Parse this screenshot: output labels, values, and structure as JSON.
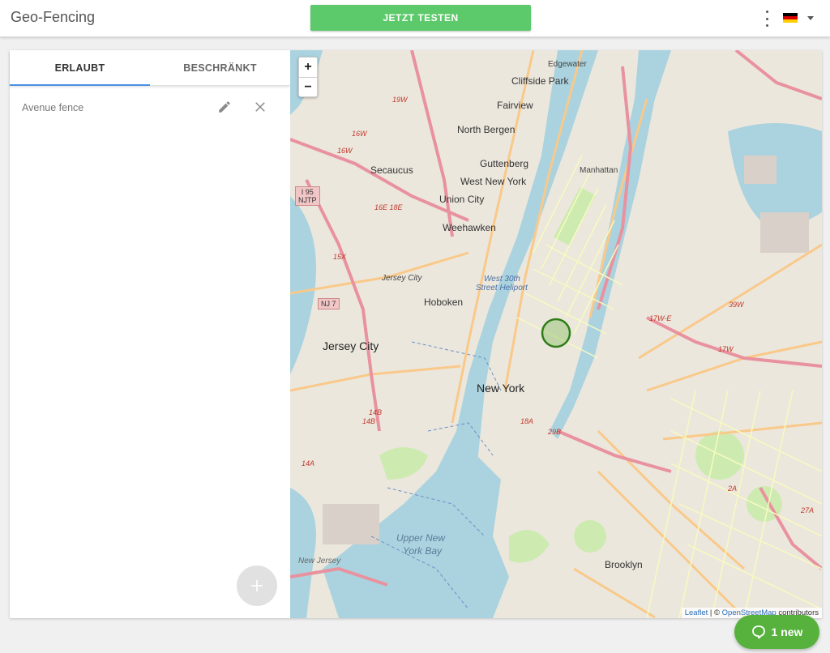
{
  "header": {
    "title": "Geo-Fencing",
    "test_button": "JETZT TESTEN",
    "language_flag": "flag-de"
  },
  "tabs": [
    {
      "label": "ERLAUBT",
      "active": true
    },
    {
      "label": "BESCHRÄNKT",
      "active": false
    }
  ],
  "fences": [
    {
      "name": "Avenue fence"
    }
  ],
  "map": {
    "zoom_in": "+",
    "zoom_out": "−",
    "places": {
      "edgewater": "Edgewater",
      "cliffside_park": "Cliffside Park",
      "fairview": "Fairview",
      "north_bergen": "North Bergen",
      "guttenberg": "Guttenberg",
      "secaucus": "Secaucus",
      "west_new_york": "West New York",
      "union_city": "Union City",
      "manhattan": "Manhattan",
      "weehawken": "Weehawken",
      "jersey_city_small": "Jersey City",
      "hoboken": "Hoboken",
      "west_30th": "West 30th",
      "street_heliport": "Street Heliport",
      "jersey_city": "Jersey City",
      "new_york": "New York",
      "upper_new_york_bay_1": "Upper New",
      "upper_new_york_bay_2": "York Bay",
      "brooklyn": "Brooklyn",
      "new_jersey": "New Jersey"
    },
    "shields": {
      "i95": "I 95",
      "njtp": "NJTP",
      "nj7": "NJ 7"
    },
    "routes": {
      "r19w": "19W",
      "r16w_a": "16W",
      "r16w_b": "16W",
      "r16e18e": "16E 18E",
      "r15x": "15X",
      "r14b_a": "14B",
      "r14b_b": "14B",
      "r14a": "14A",
      "r17we": "17W-E",
      "r17w": "17W",
      "r39w": "39W",
      "r29b": "29B",
      "r18a": "18A",
      "r27a": "27A",
      "r2a": "2A"
    },
    "attribution_leaflet": "Leaflet",
    "attribution_sep": " | © ",
    "attribution_osm": "OpenStreetMap",
    "attribution_suffix": " contributors"
  },
  "chat": {
    "label": "1 new"
  },
  "colors": {
    "accent_green": "#5cc96a",
    "tab_underline": "#4a90e2",
    "chat_green": "#56b23c",
    "fence_circle": "#2e7d18"
  }
}
